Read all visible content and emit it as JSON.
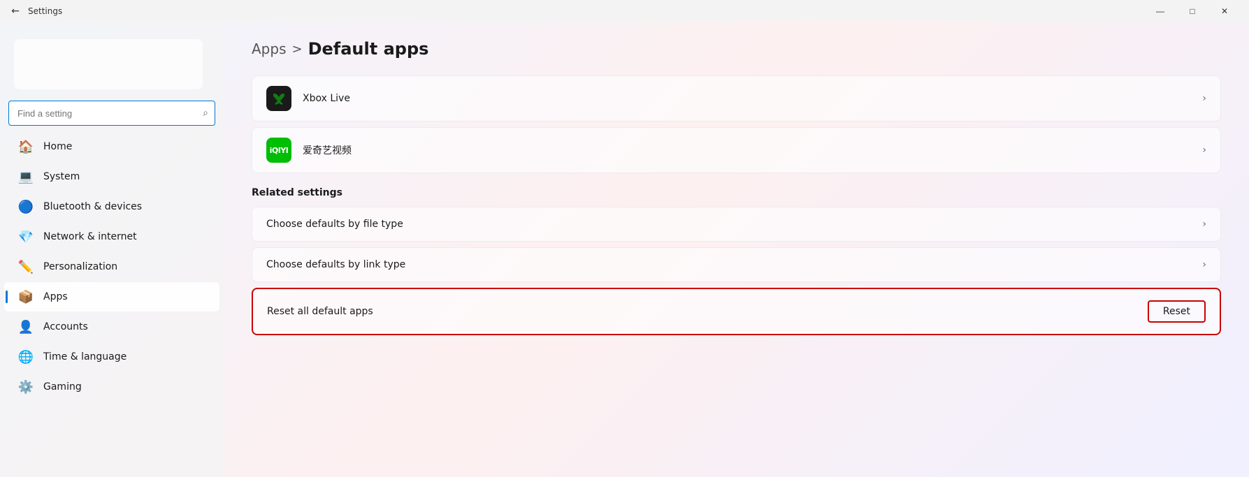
{
  "titleBar": {
    "backIcon": "←",
    "title": "Settings",
    "minIcon": "—",
    "maxIcon": "□",
    "closeIcon": "✕"
  },
  "sidebar": {
    "searchPlaceholder": "Find a setting",
    "searchIcon": "🔍",
    "navItems": [
      {
        "id": "home",
        "label": "Home",
        "icon": "🏠",
        "active": false
      },
      {
        "id": "system",
        "label": "System",
        "icon": "💻",
        "active": false
      },
      {
        "id": "bluetooth",
        "label": "Bluetooth & devices",
        "icon": "🔵",
        "active": false
      },
      {
        "id": "network",
        "label": "Network & internet",
        "icon": "💎",
        "active": false
      },
      {
        "id": "personalization",
        "label": "Personalization",
        "icon": "✏️",
        "active": false
      },
      {
        "id": "apps",
        "label": "Apps",
        "icon": "📦",
        "active": true
      },
      {
        "id": "accounts",
        "label": "Accounts",
        "icon": "👤",
        "active": false
      },
      {
        "id": "time",
        "label": "Time & language",
        "icon": "🌐",
        "active": false
      },
      {
        "id": "gaming",
        "label": "Gaming",
        "icon": "⚙️",
        "active": false
      }
    ]
  },
  "content": {
    "breadcrumb": {
      "parentLabel": "Apps",
      "separator": ">",
      "currentLabel": "Default apps"
    },
    "appItems": [
      {
        "id": "xbox",
        "name": "Xbox Live",
        "iconType": "xbox"
      },
      {
        "id": "iqiyi",
        "name": "爱奇艺视频",
        "iconType": "iqiyi"
      }
    ],
    "relatedSettings": {
      "title": "Related settings",
      "items": [
        {
          "id": "file-type",
          "label": "Choose defaults by file type"
        },
        {
          "id": "link-type",
          "label": "Choose defaults by link type"
        }
      ],
      "resetRow": {
        "label": "Reset all default apps",
        "buttonLabel": "Reset"
      }
    },
    "chevronIcon": "›"
  }
}
